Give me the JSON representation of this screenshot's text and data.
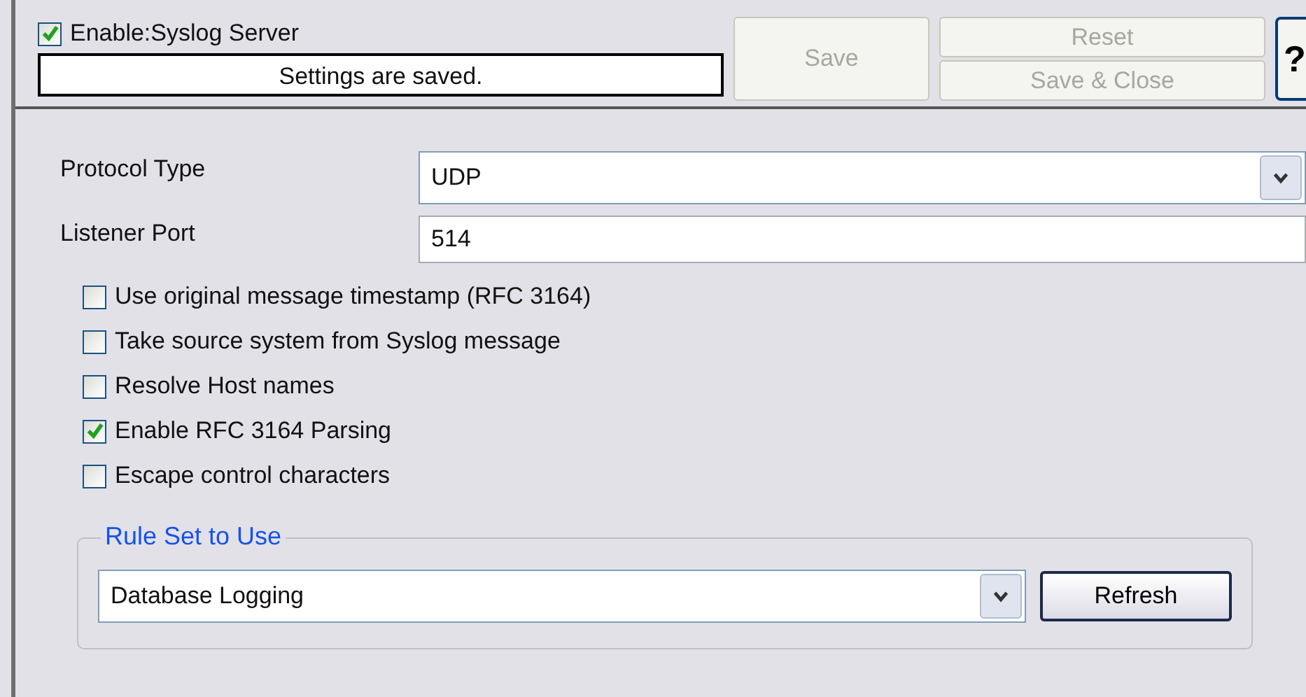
{
  "header": {
    "enable": {
      "label": "Enable:Syslog Server",
      "checked": true
    },
    "status": "Settings are saved.",
    "buttons": [
      {
        "kind": "save",
        "label": "Save",
        "disabled": true
      },
      {
        "kind": "reset",
        "label": "Reset",
        "disabled": true
      },
      {
        "kind": "save_close",
        "label": "Save & Close",
        "disabled": true
      }
    ],
    "help": "?"
  },
  "fields": [
    {
      "kind": "select",
      "label": "Protocol Type",
      "value": "UDP"
    },
    {
      "kind": "text",
      "label": "Listener Port",
      "value": "514"
    }
  ],
  "options": [
    {
      "label": "Use original message timestamp (RFC 3164)",
      "checked": false
    },
    {
      "label": "Take source system from Syslog message",
      "checked": false
    },
    {
      "label": "Resolve Host names",
      "checked": false
    },
    {
      "label": "Enable RFC 3164 Parsing",
      "checked": true
    },
    {
      "label": "Escape control characters",
      "checked": false
    }
  ],
  "rule_set": {
    "legend": "Rule Set to Use",
    "value": "Database Logging",
    "button": "Refresh"
  }
}
